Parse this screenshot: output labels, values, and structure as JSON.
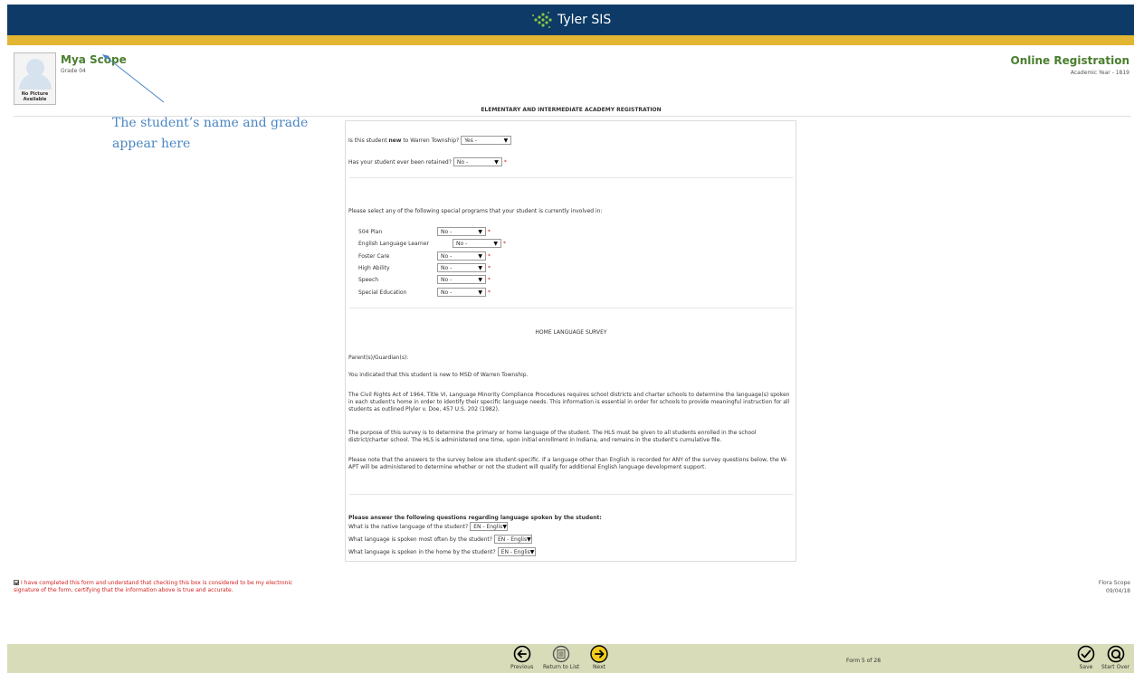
{
  "app": {
    "title": "Tyler SIS"
  },
  "student": {
    "name": "Mya Scope",
    "grade": "Grade 04",
    "photo_text": "No Picture Available"
  },
  "registration": {
    "title": "Online Registration",
    "year": "Academic Year - 1819"
  },
  "annotation": {
    "text": "The student’s name and grade appear here"
  },
  "form": {
    "title": "ELEMENTARY AND INTERMEDIATE ACADEMY REGISTRATION",
    "q_new_pre": "Is this student ",
    "q_new_bold": "new",
    "q_new_post": " to Warren Township?",
    "q_new_value": "Yes -",
    "q_retained": "Has your student ever been retained?",
    "q_retained_value": "No -",
    "programs_intro": "Please select any of the following special programs that your student is currently involved in:",
    "programs": [
      {
        "label": "504 Plan",
        "value": "No -"
      },
      {
        "label": "English Language Learner",
        "value": "No -"
      },
      {
        "label": "Foster Care",
        "value": "No -"
      },
      {
        "label": "High Ability",
        "value": "No -"
      },
      {
        "label": "Speech",
        "value": "No -"
      },
      {
        "label": "Special Education",
        "value": "No -"
      }
    ],
    "hls_title": "HOME LANGUAGE SURVEY",
    "hls_salutation": "Parent(s)/Guardian(s):",
    "hls_p1": "You indicated that this student is new to MSD of Warren Township.",
    "hls_p2": "The Civil Rights Act of 1964, Title VI, Language Minority Compliance Procedures requires school districts and charter schools to determine the language(s) spoken in each student's home in order to identify their specific language needs. This information is essential in order for schools to provide meaningful instruction for all students as outlined Plyler v. Doe, 457 U.S. 202 (1982).",
    "hls_p3": "The purpose of this survey is to determine the primary or home language of the student. The HLS must be given to all students enrolled in the school district/charter school. The HLS is administered one time, upon initial enrollment in Indiana, and remains in the student's cumulative file.",
    "hls_p4": "Please note that the answers to the survey below are student-specific. If a language other than English is recorded for ANY of the survey questions below, the W-APT will be administered to determine whether or not the student will qualify for additional English language development support.",
    "lang_heading": "Please answer the following questions regarding language spoken by the student:",
    "lang_questions": [
      {
        "label": "What is the native language of the student?",
        "value": "EN - Englis"
      },
      {
        "label": "What language is spoken most often by the student?",
        "value": "EN - Englis"
      },
      {
        "label": "What language is spoken in the home by the student?",
        "value": "EN - Englis"
      }
    ]
  },
  "signature": {
    "text": "I have completed this form and understand that checking this box is considered to be my electronic signature of the form, certifying that the information above is true and accurate.",
    "signer": "Flora Scope",
    "date": "09/04/18"
  },
  "footer": {
    "previous": "Previous",
    "return_to_list": "Return to List",
    "next": "Next",
    "form_counter": "Form 5 of 28",
    "save": "Save",
    "start_over": "Start Over"
  },
  "colors": {
    "header": "#0d3a66",
    "gold": "#e2b633",
    "accent_green": "#4a7e2e",
    "footer": "#d8dcb8",
    "required": "#d32020",
    "annotation": "#4a86c2"
  }
}
